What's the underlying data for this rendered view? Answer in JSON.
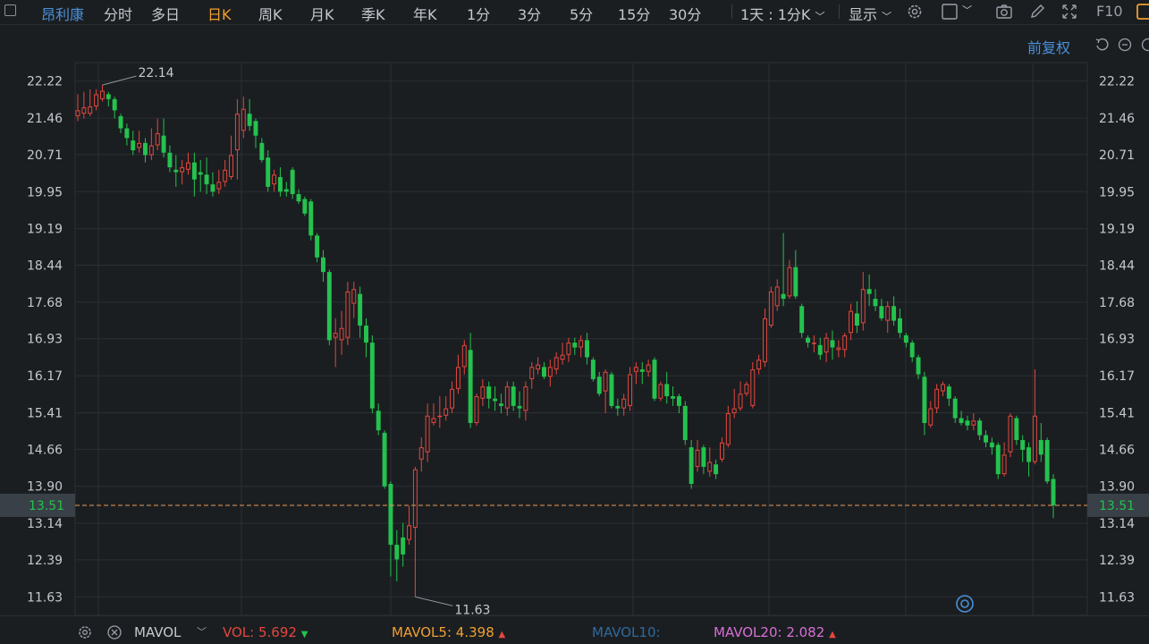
{
  "toolbar": {
    "stock_name": "昂利康",
    "periods": [
      "分时",
      "多日",
      "日K",
      "周K",
      "月K",
      "季K",
      "年K",
      "1分",
      "3分",
      "5分",
      "15分",
      "30分"
    ],
    "active_period": "日K",
    "interval": "1天 : 1分K",
    "display": "显示",
    "f10": "F10"
  },
  "adjust_label": "前复权",
  "colors": {
    "up": "#e4473e",
    "down": "#24c24e",
    "accent": "#4a90d9",
    "active": "#f0a030"
  },
  "chart_data": {
    "type": "candlestick",
    "ylim": [
      11.25,
      22.6
    ],
    "y_ticks": [
      "22.22",
      "21.46",
      "20.71",
      "19.95",
      "19.19",
      "18.44",
      "17.68",
      "16.93",
      "16.17",
      "15.41",
      "14.66",
      "13.90",
      "13.14",
      "12.39",
      "11.63"
    ],
    "current_price": "13.51",
    "high_label": "22.14",
    "low_label": "11.63",
    "candles": [
      [
        21.5,
        21.62,
        21.95,
        21.4
      ],
      [
        21.55,
        21.68,
        22.0,
        21.45
      ],
      [
        21.55,
        21.7,
        22.05,
        21.5
      ],
      [
        21.7,
        21.95,
        22.05,
        21.62
      ],
      [
        21.85,
        22.02,
        22.14,
        21.8
      ],
      [
        21.95,
        21.85,
        22.0,
        21.7
      ],
      [
        21.85,
        21.62,
        21.9,
        21.45
      ],
      [
        21.5,
        21.25,
        21.55,
        21.15
      ],
      [
        21.25,
        21.05,
        21.35,
        20.9
      ],
      [
        21.0,
        20.8,
        21.2,
        20.7
      ],
      [
        20.85,
        20.95,
        21.2,
        20.75
      ],
      [
        20.95,
        20.7,
        21.05,
        20.55
      ],
      [
        20.7,
        20.9,
        21.25,
        20.6
      ],
      [
        20.9,
        21.15,
        21.45,
        20.8
      ],
      [
        21.1,
        20.75,
        21.45,
        20.65
      ],
      [
        20.75,
        20.45,
        20.9,
        20.35
      ],
      [
        20.4,
        20.35,
        20.7,
        20.05
      ],
      [
        20.35,
        20.45,
        20.6,
        20.1
      ],
      [
        20.4,
        20.55,
        20.75,
        20.3
      ],
      [
        20.55,
        20.2,
        20.75,
        19.85
      ],
      [
        20.35,
        20.3,
        20.6,
        19.95
      ],
      [
        20.3,
        20.1,
        20.65,
        19.9
      ],
      [
        20.1,
        19.95,
        20.35,
        19.85
      ],
      [
        20.0,
        20.15,
        20.4,
        19.9
      ],
      [
        20.15,
        20.4,
        20.6,
        20.05
      ],
      [
        20.25,
        20.7,
        21.1,
        20.2
      ],
      [
        20.8,
        21.55,
        21.85,
        20.2
      ],
      [
        21.2,
        21.65,
        21.9,
        21.05
      ],
      [
        21.55,
        21.3,
        21.85,
        21.2
      ],
      [
        21.4,
        21.1,
        21.45,
        20.85
      ],
      [
        20.95,
        20.6,
        21.05,
        20.55
      ],
      [
        20.65,
        20.05,
        20.8,
        19.95
      ],
      [
        20.1,
        20.3,
        20.4,
        19.95
      ],
      [
        20.25,
        19.95,
        20.45,
        19.85
      ],
      [
        20.0,
        19.95,
        20.15,
        19.85
      ],
      [
        20.4,
        19.9,
        20.45,
        19.8
      ],
      [
        19.9,
        19.75,
        20.0,
        19.7
      ],
      [
        19.8,
        19.5,
        19.85,
        19.45
      ],
      [
        19.75,
        19.05,
        19.8,
        18.95
      ],
      [
        19.05,
        18.6,
        19.1,
        18.5
      ],
      [
        18.6,
        18.3,
        18.75,
        18.1
      ],
      [
        18.3,
        16.9,
        18.35,
        16.8
      ],
      [
        16.95,
        17.05,
        17.35,
        16.35
      ],
      [
        16.9,
        17.15,
        17.5,
        16.6
      ],
      [
        16.95,
        17.9,
        18.1,
        16.8
      ],
      [
        17.65,
        17.95,
        18.1,
        17.35
      ],
      [
        17.85,
        17.2,
        18.0,
        16.95
      ],
      [
        17.2,
        16.85,
        17.35,
        16.55
      ],
      [
        16.85,
        15.5,
        17.0,
        15.4
      ],
      [
        15.45,
        15.05,
        15.6,
        14.95
      ],
      [
        15.0,
        13.9,
        15.05,
        13.85
      ],
      [
        13.95,
        12.7,
        14.0,
        12.05
      ],
      [
        12.7,
        12.4,
        13.0,
        11.95
      ],
      [
        12.85,
        12.5,
        13.15,
        12.25
      ],
      [
        12.8,
        13.1,
        13.5,
        12.7
      ],
      [
        13.05,
        14.25,
        14.3,
        11.63
      ],
      [
        14.45,
        14.7,
        14.9,
        14.2
      ],
      [
        14.6,
        15.35,
        15.6,
        14.4
      ],
      [
        15.2,
        15.3,
        15.6,
        15.15
      ],
      [
        15.35,
        15.35,
        15.75,
        15.1
      ],
      [
        15.35,
        15.5,
        15.75,
        15.25
      ],
      [
        15.5,
        15.9,
        16.05,
        15.4
      ],
      [
        15.9,
        16.35,
        16.6,
        15.8
      ],
      [
        16.35,
        16.8,
        16.9,
        16.2
      ],
      [
        16.7,
        15.2,
        17.05,
        15.1
      ],
      [
        15.2,
        15.75,
        15.8,
        15.15
      ],
      [
        15.7,
        15.95,
        16.1,
        15.55
      ],
      [
        15.95,
        15.7,
        16.05,
        15.5
      ],
      [
        15.7,
        15.65,
        15.95,
        15.45
      ],
      [
        15.6,
        15.55,
        15.8,
        15.4
      ],
      [
        15.5,
        15.95,
        16.05,
        15.35
      ],
      [
        15.95,
        15.55,
        16.05,
        15.45
      ],
      [
        15.55,
        15.5,
        15.85,
        15.3
      ],
      [
        15.45,
        15.95,
        16.05,
        15.25
      ],
      [
        16.1,
        16.35,
        16.45,
        15.9
      ],
      [
        16.3,
        16.4,
        16.55,
        16.2
      ],
      [
        16.35,
        16.15,
        16.45,
        16.1
      ],
      [
        16.15,
        16.35,
        16.5,
        15.95
      ],
      [
        16.3,
        16.55,
        16.65,
        16.2
      ],
      [
        16.5,
        16.6,
        16.85,
        16.4
      ],
      [
        16.6,
        16.85,
        16.95,
        16.45
      ],
      [
        16.85,
        16.75,
        16.95,
        16.6
      ],
      [
        16.75,
        16.9,
        17.0,
        16.55
      ],
      [
        16.9,
        16.55,
        17.05,
        16.4
      ],
      [
        16.5,
        16.1,
        16.55,
        16.05
      ],
      [
        16.15,
        15.8,
        16.25,
        15.75
      ],
      [
        15.85,
        16.25,
        16.3,
        15.4
      ],
      [
        16.2,
        15.55,
        16.25,
        15.5
      ],
      [
        15.55,
        15.5,
        15.7,
        15.35
      ],
      [
        15.5,
        15.7,
        15.8,
        15.35
      ],
      [
        15.55,
        16.2,
        16.35,
        15.45
      ],
      [
        16.25,
        16.35,
        16.45,
        16.0
      ],
      [
        16.3,
        16.25,
        16.45,
        16.0
      ],
      [
        16.25,
        16.4,
        16.5,
        16.15
      ],
      [
        16.5,
        15.7,
        16.55,
        15.65
      ],
      [
        15.7,
        16.0,
        16.05,
        15.65
      ],
      [
        16.0,
        15.75,
        16.25,
        15.6
      ],
      [
        15.75,
        15.7,
        15.95,
        15.55
      ],
      [
        15.75,
        15.55,
        15.8,
        15.4
      ],
      [
        15.55,
        14.85,
        15.65,
        14.75
      ],
      [
        14.7,
        13.95,
        14.85,
        13.85
      ],
      [
        14.3,
        14.65,
        14.85,
        14.2
      ],
      [
        14.7,
        14.3,
        14.75,
        14.15
      ],
      [
        14.2,
        14.4,
        14.7,
        14.1
      ],
      [
        14.35,
        14.15,
        14.45,
        14.05
      ],
      [
        14.45,
        14.8,
        14.9,
        14.4
      ],
      [
        14.75,
        15.4,
        15.55,
        14.7
      ],
      [
        15.4,
        15.5,
        15.9,
        15.3
      ],
      [
        15.5,
        15.8,
        16.05,
        15.45
      ],
      [
        15.8,
        16.0,
        16.05,
        15.75
      ],
      [
        15.55,
        16.3,
        16.45,
        15.5
      ],
      [
        16.3,
        16.5,
        16.6,
        16.2
      ],
      [
        16.45,
        17.35,
        17.55,
        16.35
      ],
      [
        17.2,
        17.9,
        18.0,
        17.15
      ],
      [
        17.6,
        18.0,
        18.15,
        17.5
      ],
      [
        17.85,
        17.75,
        19.1,
        17.6
      ],
      [
        17.8,
        18.4,
        18.55,
        17.75
      ],
      [
        18.4,
        17.8,
        18.75,
        17.75
      ],
      [
        17.6,
        17.05,
        17.65,
        16.95
      ],
      [
        16.95,
        16.85,
        17.0,
        16.75
      ],
      [
        16.85,
        16.85,
        17.0,
        16.65
      ],
      [
        16.8,
        16.6,
        16.95,
        16.5
      ],
      [
        16.65,
        16.95,
        17.05,
        16.45
      ],
      [
        16.9,
        16.75,
        17.1,
        16.5
      ],
      [
        16.7,
        16.75,
        16.9,
        16.55
      ],
      [
        16.7,
        17.0,
        17.05,
        16.55
      ],
      [
        17.05,
        17.5,
        17.65,
        16.9
      ],
      [
        17.45,
        17.2,
        17.7,
        17.05
      ],
      [
        17.25,
        17.95,
        18.3,
        17.1
      ],
      [
        17.95,
        17.85,
        18.25,
        17.6
      ],
      [
        17.75,
        17.6,
        17.95,
        17.5
      ],
      [
        17.6,
        17.35,
        17.75,
        17.3
      ],
      [
        17.3,
        17.6,
        17.7,
        17.05
      ],
      [
        17.6,
        17.3,
        17.8,
        17.2
      ],
      [
        17.35,
        17.05,
        17.55,
        16.95
      ],
      [
        17.0,
        16.85,
        17.05,
        16.75
      ],
      [
        16.85,
        16.55,
        16.9,
        16.45
      ],
      [
        16.55,
        16.2,
        16.6,
        16.1
      ],
      [
        16.15,
        15.2,
        16.25,
        14.95
      ],
      [
        15.15,
        15.5,
        15.65,
        15.1
      ],
      [
        15.5,
        15.9,
        16.0,
        15.4
      ],
      [
        15.85,
        16.0,
        16.05,
        15.75
      ],
      [
        15.95,
        15.7,
        16.0,
        15.55
      ],
      [
        15.7,
        15.3,
        15.75,
        15.2
      ],
      [
        15.3,
        15.2,
        15.45,
        15.15
      ],
      [
        15.25,
        15.15,
        15.35,
        15.05
      ],
      [
        15.15,
        15.25,
        15.4,
        15.05
      ],
      [
        15.25,
        14.95,
        15.3,
        14.85
      ],
      [
        14.95,
        14.8,
        15.05,
        14.7
      ],
      [
        14.8,
        14.7,
        14.9,
        14.55
      ],
      [
        14.75,
        14.15,
        14.8,
        14.05
      ],
      [
        14.15,
        14.55,
        14.8,
        14.1
      ],
      [
        14.6,
        15.35,
        15.4,
        14.5
      ],
      [
        15.3,
        14.85,
        15.35,
        14.75
      ],
      [
        14.85,
        14.65,
        14.95,
        14.4
      ],
      [
        14.7,
        14.4,
        14.8,
        14.1
      ],
      [
        14.4,
        15.35,
        16.3,
        14.35
      ],
      [
        14.85,
        14.55,
        15.2,
        14.4
      ],
      [
        14.85,
        14.0,
        14.9,
        13.95
      ],
      [
        14.05,
        13.51,
        14.15,
        13.25
      ]
    ]
  },
  "bottom_bar": {
    "indicator": "MAVOL",
    "vol_label": "VOL:",
    "vol_value": "5.692",
    "mavol5_label": "MAVOL5:",
    "mavol5_value": "4.398",
    "mavol10_label": "MAVOL10:",
    "mavol20_label": "MAVOL20:",
    "mavol20_value": "2.082"
  }
}
